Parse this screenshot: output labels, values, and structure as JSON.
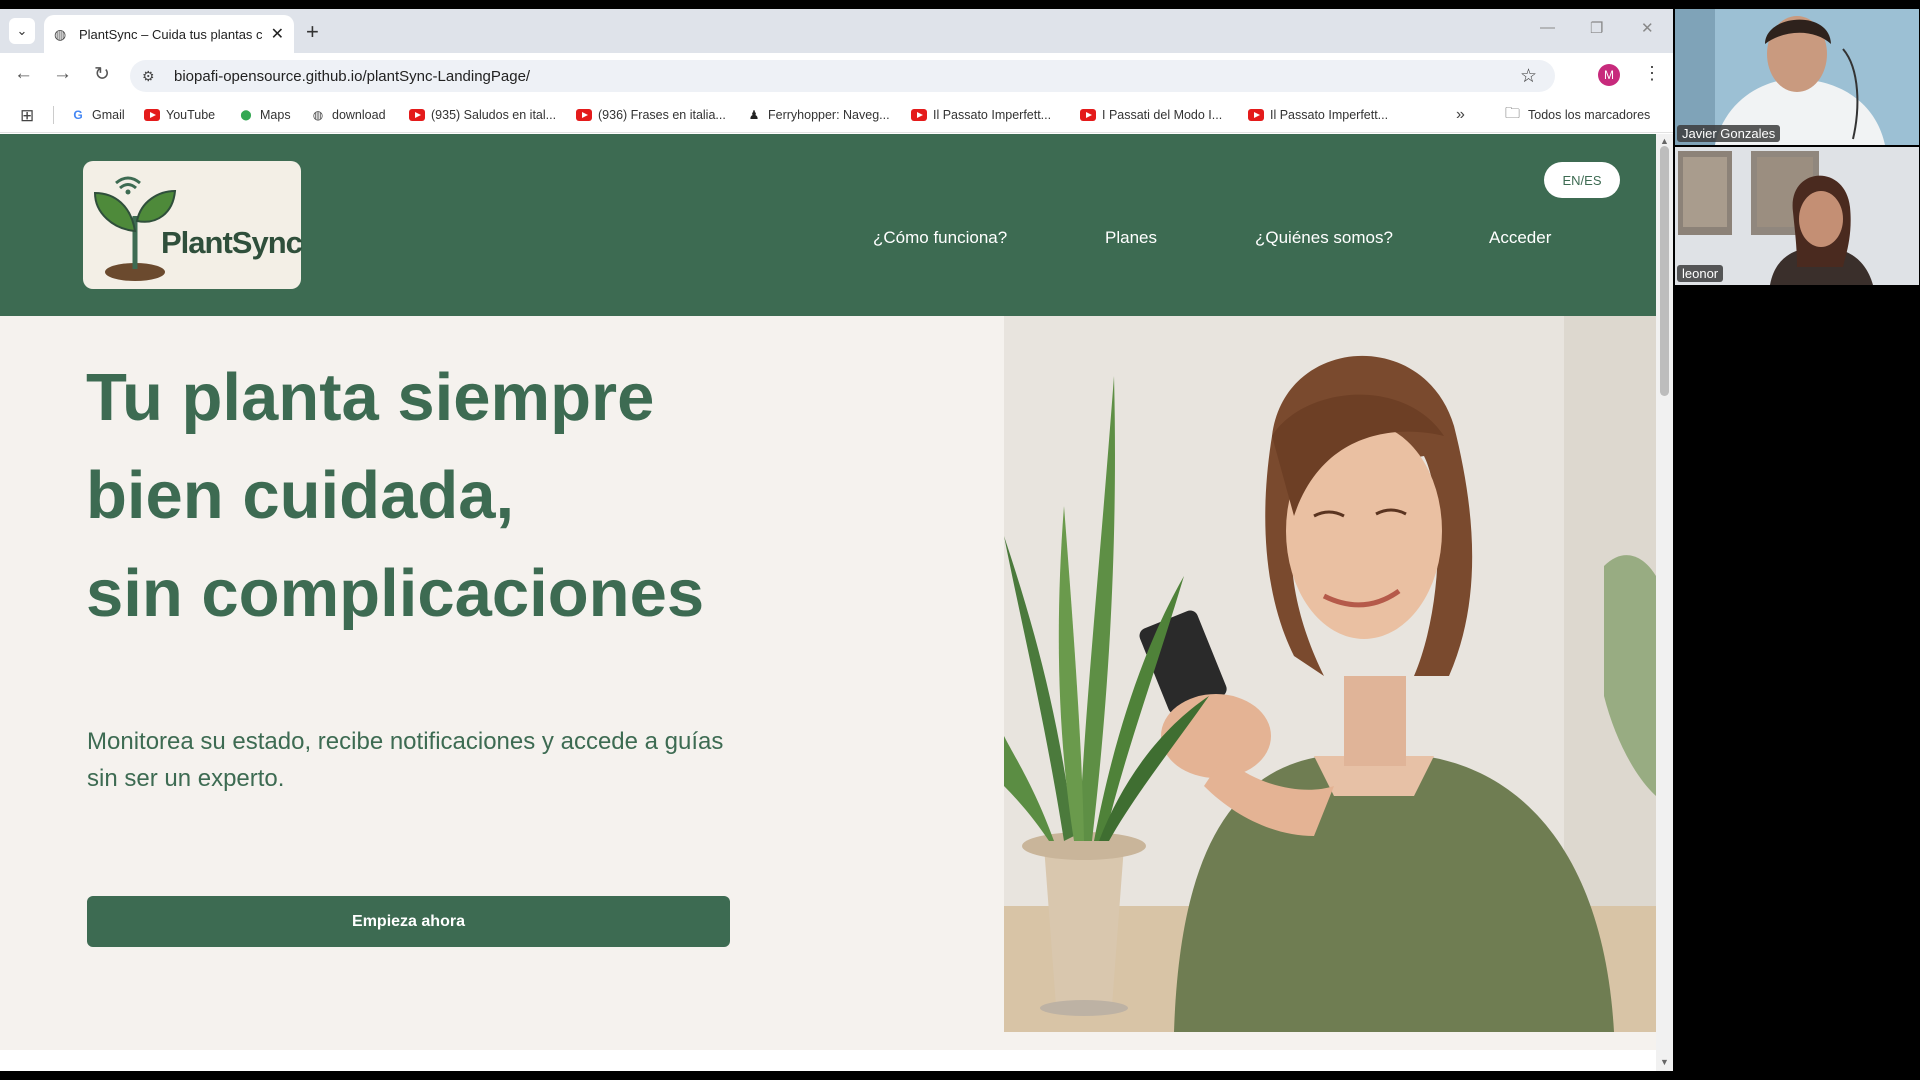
{
  "browser": {
    "tab_title": "PlantSync – Cuida tus plantas c",
    "url": "biopafi-opensource.github.io/plantSync-LandingPage/",
    "profile_initial": "M",
    "bookmarks": [
      {
        "label": "Gmail",
        "icon": "google-icon"
      },
      {
        "label": "YouTube",
        "icon": "youtube-icon"
      },
      {
        "label": "Maps",
        "icon": "maps-pin-icon"
      },
      {
        "label": "download",
        "icon": "globe-icon"
      },
      {
        "label": "(935) Saludos en ital...",
        "icon": "youtube-icon"
      },
      {
        "label": "(936) Frases en italia...",
        "icon": "youtube-icon"
      },
      {
        "label": "Ferryhopper: Naveg...",
        "icon": "ferryhopper-icon"
      },
      {
        "label": "Il Passato Imperfett...",
        "icon": "youtube-icon"
      },
      {
        "label": "I Passati del Modo I...",
        "icon": "youtube-icon"
      },
      {
        "label": "Il Passato Imperfett...",
        "icon": "youtube-icon"
      }
    ],
    "all_bookmarks": "Todos los marcadores"
  },
  "site": {
    "logo_text": "PlantSync",
    "lang_toggle": "EN/ES",
    "nav": [
      "¿Cómo funciona?",
      "Planes",
      "¿Quiénes somos?",
      "Acceder"
    ],
    "hero_lines": [
      "Tu planta siempre",
      "bien cuidada,",
      "sin complicaciones"
    ],
    "hero_sub": "Monitorea su estado, recibe notificaciones y accede a guías sin ser un experto.",
    "cta": "Empieza ahora",
    "colors": {
      "brand_green": "#3d6b52",
      "background": "#f5f2ee",
      "logo_bg": "#f3efe6"
    }
  },
  "call": {
    "participants": [
      {
        "name": "Javier Gonzales"
      },
      {
        "name": "leonor"
      }
    ]
  }
}
